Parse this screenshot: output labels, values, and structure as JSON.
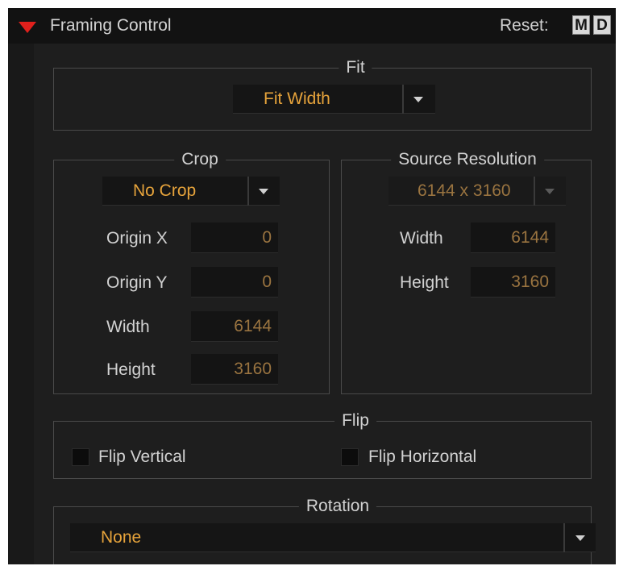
{
  "header": {
    "title": "Framing Control",
    "reset_label": "Reset:",
    "m_label": "M",
    "d_label": "D"
  },
  "fit": {
    "legend": "Fit",
    "selected": "Fit Width"
  },
  "crop": {
    "legend": "Crop",
    "selected": "No Crop",
    "fields": [
      {
        "label": "Origin X",
        "value": "0"
      },
      {
        "label": "Origin Y",
        "value": "0"
      },
      {
        "label": "Width",
        "value": "6144"
      },
      {
        "label": "Height",
        "value": "3160"
      }
    ]
  },
  "source": {
    "legend": "Source Resolution",
    "selected": "6144 x 3160",
    "fields": [
      {
        "label": "Width",
        "value": "6144"
      },
      {
        "label": "Height",
        "value": "3160"
      }
    ]
  },
  "flip": {
    "legend": "Flip",
    "vertical_label": "Flip Vertical",
    "horizontal_label": "Flip Horizontal"
  },
  "rotation": {
    "legend": "Rotation",
    "selected": "None"
  },
  "colors": {
    "accent": "#e6a33b",
    "header_triangle": "#e0201c",
    "panel_bg": "#1e1e1e"
  }
}
